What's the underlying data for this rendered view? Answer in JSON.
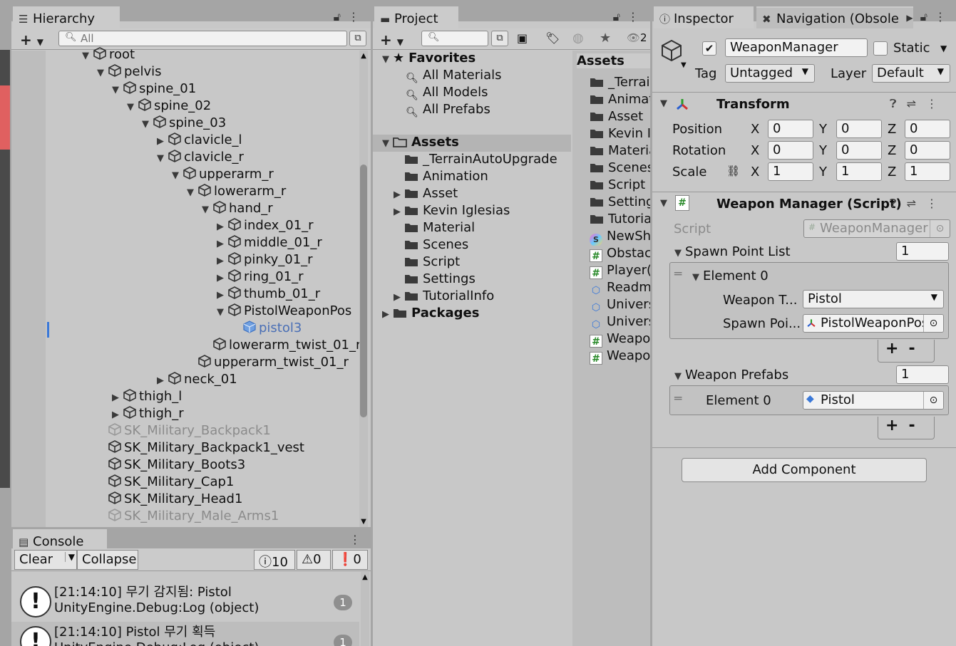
{
  "hierarchy": {
    "tab_label": "Hierarchy",
    "search_placeholder": "All",
    "rows": [
      {
        "label": "root",
        "depth": 0,
        "arrow": "▼"
      },
      {
        "label": "pelvis",
        "depth": 1,
        "arrow": "▼"
      },
      {
        "label": "spine_01",
        "depth": 2,
        "arrow": "▼"
      },
      {
        "label": "spine_02",
        "depth": 3,
        "arrow": "▼"
      },
      {
        "label": "spine_03",
        "depth": 4,
        "arrow": "▼"
      },
      {
        "label": "clavicle_l",
        "depth": 5,
        "arrow": "▶"
      },
      {
        "label": "clavicle_r",
        "depth": 5,
        "arrow": "▼"
      },
      {
        "label": "upperarm_r",
        "depth": 6,
        "arrow": "▼"
      },
      {
        "label": "lowerarm_r",
        "depth": 7,
        "arrow": "▼"
      },
      {
        "label": "hand_r",
        "depth": 8,
        "arrow": "▼"
      },
      {
        "label": "index_01_r",
        "depth": 9,
        "arrow": "▶"
      },
      {
        "label": "middle_01_r",
        "depth": 9,
        "arrow": "▶"
      },
      {
        "label": "pinky_01_r",
        "depth": 9,
        "arrow": "▶"
      },
      {
        "label": "ring_01_r",
        "depth": 9,
        "arrow": "▶"
      },
      {
        "label": "thumb_01_r",
        "depth": 9,
        "arrow": "▶"
      },
      {
        "label": "PistolWeaponPos",
        "depth": 9,
        "arrow": "▼"
      },
      {
        "label": "pistol3",
        "depth": 10,
        "arrow": "",
        "style": "blue"
      },
      {
        "label": "lowerarm_twist_01_r",
        "depth": 8,
        "arrow": ""
      },
      {
        "label": "upperarm_twist_01_r",
        "depth": 7,
        "arrow": ""
      },
      {
        "label": "neck_01",
        "depth": 5,
        "arrow": "▶"
      },
      {
        "label": "thigh_l",
        "depth": 2,
        "arrow": "▶"
      },
      {
        "label": "thigh_r",
        "depth": 2,
        "arrow": "▶"
      },
      {
        "label": "SK_Military_Backpack1",
        "depth": 1,
        "arrow": "",
        "style": "gray"
      },
      {
        "label": "SK_Military_Backpack1_vest",
        "depth": 1,
        "arrow": ""
      },
      {
        "label": "SK_Military_Boots3",
        "depth": 1,
        "arrow": ""
      },
      {
        "label": "SK_Military_Cap1",
        "depth": 1,
        "arrow": ""
      },
      {
        "label": "SK_Military_Head1",
        "depth": 1,
        "arrow": ""
      },
      {
        "label": "SK_Military_Male_Arms1",
        "depth": 1,
        "arrow": "",
        "style": "gray"
      }
    ]
  },
  "console": {
    "tab_label": "Console",
    "clear_label": "Clear",
    "collapse_label": "Collapse",
    "info_count": "10",
    "warn_count": "0",
    "error_count": "0",
    "logs": [
      {
        "line1": "[21:14:10] 무기 감지됨: Pistol",
        "line2": "UnityEngine.Debug:Log (object)",
        "count": "1"
      },
      {
        "line1": "[21:14:10] Pistol 무기 획득",
        "line2": "UnityEngine.Debug:Log (object)",
        "count": "1"
      }
    ]
  },
  "project": {
    "tab_label": "Project",
    "hidden_count": "2",
    "favorites_label": "Favorites",
    "favorites": [
      "All Materials",
      "All Models",
      "All Prefabs"
    ],
    "assets_label": "Assets",
    "asset_folders": [
      {
        "label": "_TerrainAutoUpgrade",
        "arrow": ""
      },
      {
        "label": "Animation",
        "arrow": ""
      },
      {
        "label": "Asset",
        "arrow": "▶"
      },
      {
        "label": "Kevin Iglesias",
        "arrow": "▶"
      },
      {
        "label": "Material",
        "arrow": ""
      },
      {
        "label": "Scenes",
        "arrow": ""
      },
      {
        "label": "Script",
        "arrow": ""
      },
      {
        "label": "Settings",
        "arrow": ""
      },
      {
        "label": "TutorialInfo",
        "arrow": "▶"
      }
    ],
    "packages_label": "Packages",
    "right_header": "Assets",
    "right_items": [
      {
        "label": "_Terrai",
        "icon": "folder"
      },
      {
        "label": "Animat",
        "icon": "folder"
      },
      {
        "label": "Asset",
        "icon": "folder"
      },
      {
        "label": "Kevin I",
        "icon": "folder"
      },
      {
        "label": "Materia",
        "icon": "folder"
      },
      {
        "label": "Scenes",
        "icon": "folder"
      },
      {
        "label": "Script",
        "icon": "folder"
      },
      {
        "label": "Setting",
        "icon": "folder"
      },
      {
        "label": "Tutoria",
        "icon": "folder"
      },
      {
        "label": "NewSh",
        "icon": "shader"
      },
      {
        "label": "Obstac",
        "icon": "script"
      },
      {
        "label": "Player(",
        "icon": "script"
      },
      {
        "label": "Readm",
        "icon": "asset"
      },
      {
        "label": "Univers",
        "icon": "asset"
      },
      {
        "label": "Univers",
        "icon": "asset"
      },
      {
        "label": "Weapo",
        "icon": "script"
      },
      {
        "label": "Weapo",
        "icon": "script"
      }
    ]
  },
  "inspector": {
    "tab_label": "Inspector",
    "nav_tab_label": "Navigation (Obsole",
    "object_name": "WeaponManager",
    "static_label": "Static",
    "tag_label": "Tag",
    "tag_value": "Untagged",
    "layer_label": "Layer",
    "layer_value": "Default",
    "transform": {
      "title": "Transform",
      "position_label": "Position",
      "rotation_label": "Rotation",
      "scale_label": "Scale",
      "x": "X",
      "y": "Y",
      "z": "Z",
      "position": [
        "0",
        "0",
        "0"
      ],
      "rotation": [
        "0",
        "0",
        "0"
      ],
      "scale": [
        "1",
        "1",
        "1"
      ]
    },
    "script_component": {
      "title": "Weapon Manager (Script)",
      "script_label": "Script",
      "script_value": "WeaponManager",
      "spawn_list_label": "Spawn Point List",
      "spawn_list_size": "1",
      "element0_label": "Element 0",
      "weapon_type_label": "Weapon T...",
      "weapon_type_value": "Pistol",
      "spawn_point_label": "Spawn Poi...",
      "spawn_point_value": "PistolWeaponPos",
      "prefabs_label": "Weapon Prefabs",
      "prefabs_size": "1",
      "prefab_element_label": "Element 0",
      "prefab_element_value": "Pistol",
      "plus": "+",
      "minus": "-"
    },
    "add_component_label": "Add Component"
  }
}
